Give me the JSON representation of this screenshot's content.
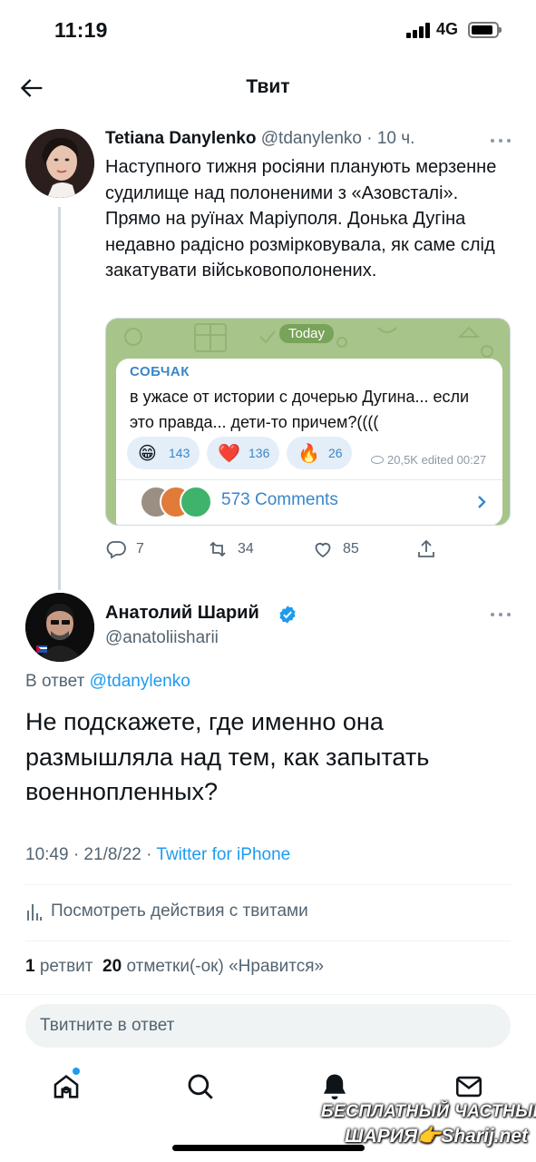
{
  "status_bar": {
    "time": "11:19",
    "network": "4G"
  },
  "header": {
    "title": "Твит"
  },
  "parent_tweet": {
    "author_name": "Tetiana Danylenko",
    "author_handle": "@tdanylenko",
    "time_ago": "· 10 ч.",
    "text": "Наступного тижня росіяни планують мерзенне судилище над полоненими з «Азовсталі». Прямо на руїнах Маріуполя. Донька Дугіна недавно радісно розмірковувала, як саме слід закатувати військовополонених.",
    "embedded_image": {
      "date_chip": "Today",
      "channel": "СОБЧАК",
      "message": "в ужасе от истории с дочерью Дугина... если это правда... дети-то причем?((((",
      "reactions": [
        {
          "emoji": "😁",
          "count": "143"
        },
        {
          "emoji": "❤️",
          "count": "136"
        },
        {
          "emoji": "🔥",
          "count": "26"
        }
      ],
      "views_edited": "20,5K edited 00:27",
      "comments": "573 Comments"
    },
    "actions": {
      "replies": "7",
      "retweets": "34",
      "likes": "85"
    }
  },
  "main_tweet": {
    "author_name": "Анатолий Шарий",
    "author_handle": "@anatoliisharii",
    "reply_prefix": "В ответ",
    "reply_mention": "@tdanylenko",
    "text": "Не подскажете, где именно она размышляла над тем, как запытать военнопленных?",
    "timestamp": "10:49 · 21/8/22 · ",
    "source": "Twitter for iPhone",
    "analytics_label": "Посмотреть действия с твитами",
    "retweet_count": "1",
    "retweet_label": "ретвит",
    "like_count": "20",
    "like_label": "отметки(-ок) «Нравится»"
  },
  "reply_box": {
    "placeholder": "Твитните в ответ"
  },
  "tab_bar": {
    "items": [
      "home-icon",
      "search-icon",
      "notifications-icon",
      "messages-icon"
    ]
  },
  "watermark": {
    "line1": "БЕСПЛАТНЫЙ ЧАСТНЫЙ",
    "line2": "ШАРИЯ👉Sharij.net"
  },
  "colors": {
    "accent": "#1d9bf0",
    "secondary_text": "#536471",
    "telegram_bg": "#a7c48a"
  }
}
